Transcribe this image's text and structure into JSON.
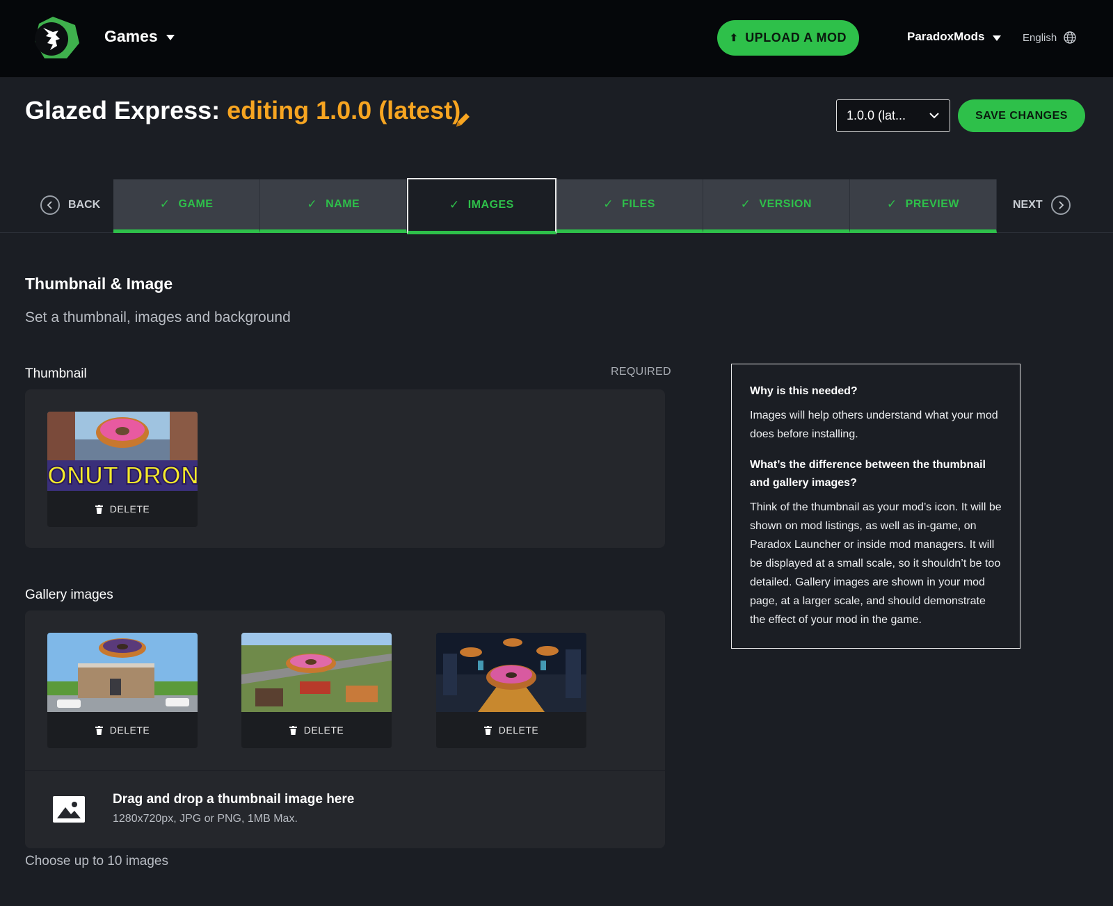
{
  "header": {
    "games_label": "Games",
    "upload_label": "UPLOAD A MOD",
    "user_label": "ParadoxMods",
    "language_label": "English"
  },
  "title": {
    "mod_name": "Glazed Express:",
    "editing": "editing 1.0.0 (latest)"
  },
  "version_select": {
    "value": "1.0.0 (lat..."
  },
  "save_label": "SAVE CHANGES",
  "stepper": {
    "back_label": "BACK",
    "next_label": "NEXT",
    "tabs": [
      {
        "label": "GAME"
      },
      {
        "label": "NAME"
      },
      {
        "label": "IMAGES"
      },
      {
        "label": "FILES"
      },
      {
        "label": "VERSION"
      },
      {
        "label": "PREVIEW"
      }
    ]
  },
  "section": {
    "title": "Thumbnail & Image",
    "subtitle": "Set a thumbnail, images and background"
  },
  "thumbnail": {
    "label": "Thumbnail",
    "required": "REQUIRED",
    "image_text": "DONUT DRONE",
    "delete_label": "DELETE"
  },
  "gallery": {
    "label": "Gallery images",
    "delete_label": "DELETE"
  },
  "dropzone": {
    "title": "Drag and drop a thumbnail image here",
    "hint": "1280x720px, JPG or PNG, 1MB Max."
  },
  "choose_text": "Choose up to 10 images",
  "info": {
    "q1": "Why is this needed?",
    "a1": "Images will help others understand what your mod does before installing.",
    "q2": "What’s the difference between the thumbnail and gallery images?",
    "a2": "Think of the thumbnail as your mod’s icon. It will be shown on mod listings, as well as in-game, on Paradox Launcher or inside mod managers. It will be displayed at a small scale, so it shouldn’t be too detailed. Gallery images are shown in your mod page, at a larger scale, and should demonstrate the effect of your mod in the game."
  },
  "colors": {
    "accent_green": "#2ec04a",
    "accent_orange": "#f7a521",
    "header_bg": "#05070a",
    "page_bg": "#1b1e24"
  }
}
